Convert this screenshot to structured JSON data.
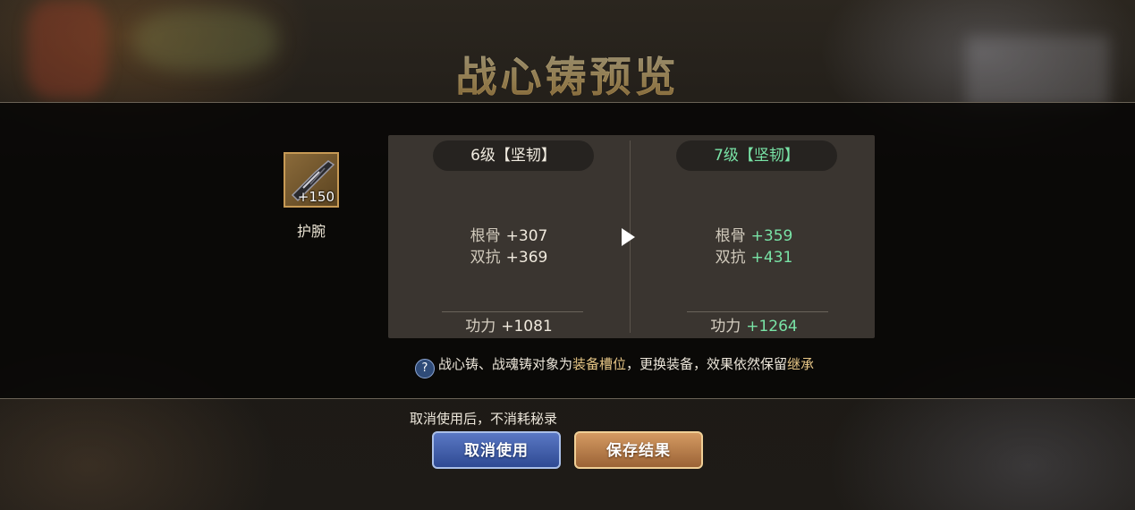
{
  "title": "战心铸预览",
  "item": {
    "name": "护腕",
    "plus": "+150",
    "icon": "bracer-icon"
  },
  "left": {
    "level": "6级【坚韧】",
    "stats": [
      {
        "label": "根骨",
        "value": "+307"
      },
      {
        "label": "双抗",
        "value": "+369"
      }
    ],
    "power": {
      "label": "功力",
      "value": "+1081"
    }
  },
  "right": {
    "level": "7级【坚韧】",
    "stats": [
      {
        "label": "根骨",
        "value": "+359"
      },
      {
        "label": "双抗",
        "value": "+431"
      }
    ],
    "power": {
      "label": "功力",
      "value": "+1264"
    }
  },
  "note": {
    "icon": "?",
    "part1": "战心铸、战魂铸对象为",
    "highlight1": "装备槽位",
    "part2": "，更换装备，效果依然保留",
    "highlight2": "继承"
  },
  "cancel_tip": "取消使用后，不消耗秘录",
  "buttons": {
    "cancel": "取消使用",
    "save": "保存结果"
  },
  "colors": {
    "gain": "#79e3a6",
    "highlight": "#e7c686",
    "title": "#f3cf84"
  }
}
